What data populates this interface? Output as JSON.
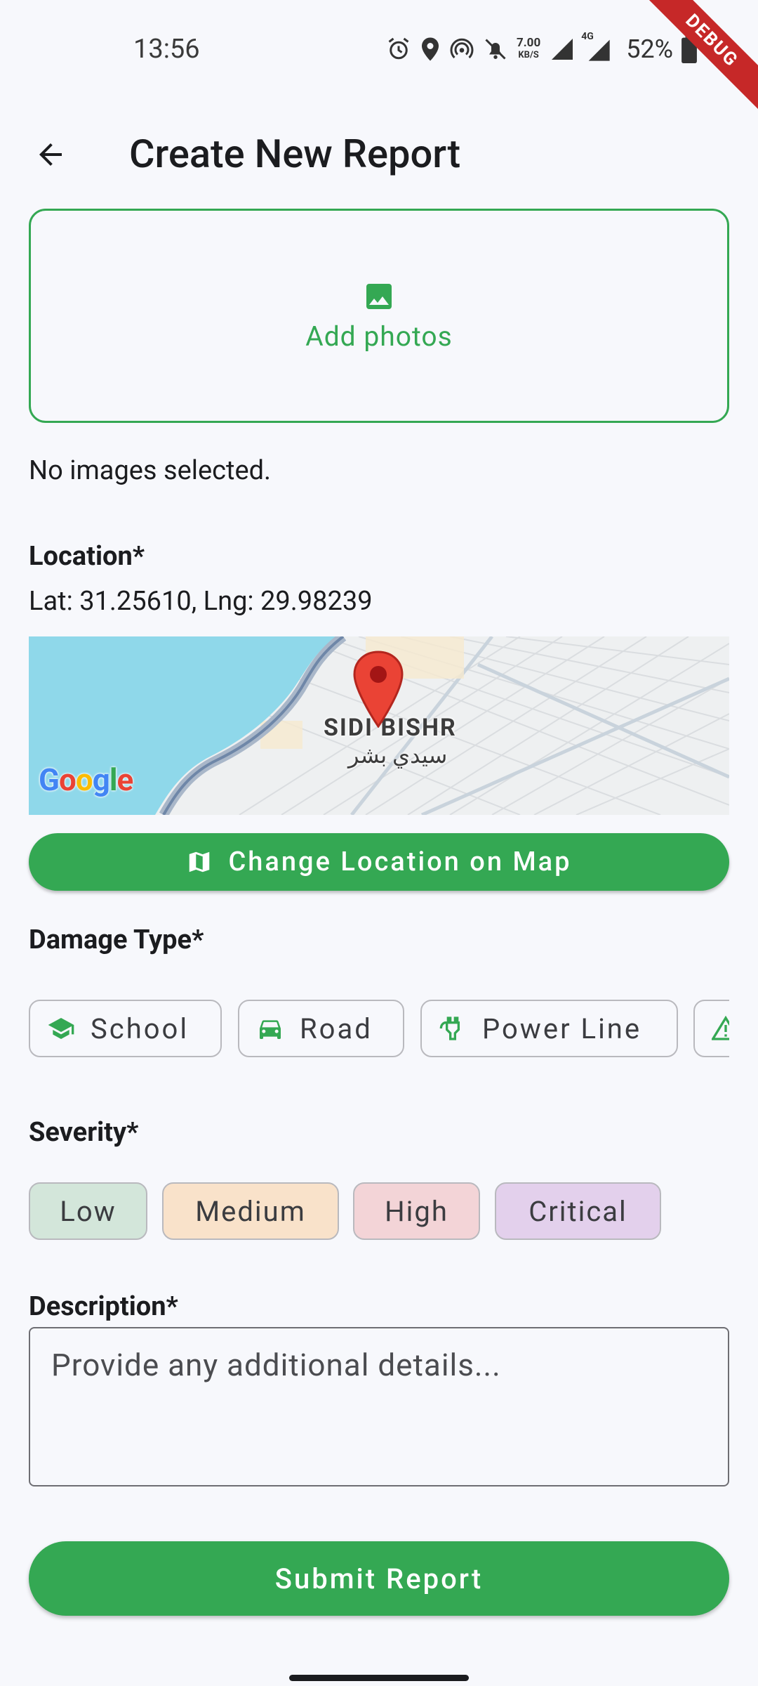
{
  "status_bar": {
    "time": "13:56",
    "net_speed_value": "7.00",
    "net_speed_unit": "KB/S",
    "network_label": "4G",
    "battery": "52%",
    "icons": [
      "alarm-icon",
      "location-icon",
      "hotspot-icon",
      "bell-off-icon",
      "signal-icon",
      "signal-4g-icon",
      "battery-icon"
    ]
  },
  "debug_banner": "DEBUG",
  "app_bar": {
    "title": "Create New Report",
    "back_icon": "arrow-left-icon"
  },
  "photos": {
    "add_label": "Add photos",
    "icon": "image-icon",
    "status": "No images selected."
  },
  "location": {
    "label": "Location*",
    "coords": "Lat: 31.25610, Lng: 29.98239",
    "map": {
      "place_label_en": "SIDI BISHR",
      "place_label_ar": "سيدي بشر",
      "attribution": "Google"
    },
    "change_button": "Change Location on Map",
    "change_icon": "map-icon"
  },
  "damage_type": {
    "label": "Damage Type*",
    "options": [
      {
        "label": "School",
        "icon": "school-icon"
      },
      {
        "label": "Road",
        "icon": "car-icon"
      },
      {
        "label": "Power Line",
        "icon": "power-plug-icon"
      },
      {
        "label": "",
        "icon": "warning-icon"
      }
    ]
  },
  "severity": {
    "label": "Severity*",
    "options": [
      {
        "label": "Low",
        "color": "#d3e6da"
      },
      {
        "label": "Medium",
        "color": "#f9e2ca"
      },
      {
        "label": "High",
        "color": "#f3d4d7"
      },
      {
        "label": "Critical",
        "color": "#e3d0ec"
      }
    ]
  },
  "description": {
    "label": "Description*",
    "placeholder": "Provide any additional details..."
  },
  "submit_button": "Submit Report",
  "colors": {
    "primary": "#34a853",
    "background": "#f7f8fc"
  }
}
